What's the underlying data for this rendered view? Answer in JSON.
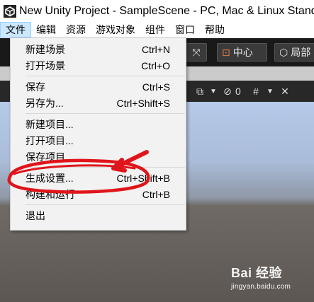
{
  "window": {
    "title": "New Unity Project - SampleScene - PC, Mac & Linux Standalone"
  },
  "menubar": {
    "items": [
      "文件",
      "编辑",
      "资源",
      "游戏对象",
      "组件",
      "窗口",
      "帮助"
    ]
  },
  "toolbar": {
    "pivot_label": "中心",
    "local_label": "局部"
  },
  "scene_toolbar": {
    "hidden_count": "0"
  },
  "file_menu": {
    "groups": [
      [
        {
          "label": "新建场景",
          "shortcut": "Ctrl+N"
        },
        {
          "label": "打开场景",
          "shortcut": "Ctrl+O"
        }
      ],
      [
        {
          "label": "保存",
          "shortcut": "Ctrl+S"
        },
        {
          "label": "另存为...",
          "shortcut": "Ctrl+Shift+S"
        }
      ],
      [
        {
          "label": "新建项目...",
          "shortcut": ""
        },
        {
          "label": "打开项目...",
          "shortcut": ""
        },
        {
          "label": "保存项目",
          "shortcut": ""
        }
      ],
      [
        {
          "label": "生成设置...",
          "shortcut": "Ctrl+Shift+B"
        },
        {
          "label": "构建和运行",
          "shortcut": "Ctrl+B"
        }
      ],
      [
        {
          "label": "退出",
          "shortcut": ""
        }
      ]
    ]
  },
  "annotation": {
    "color": "#e0151b"
  },
  "watermark": {
    "brand": "Bai 经验",
    "url": "jingyan.baidu.com"
  }
}
